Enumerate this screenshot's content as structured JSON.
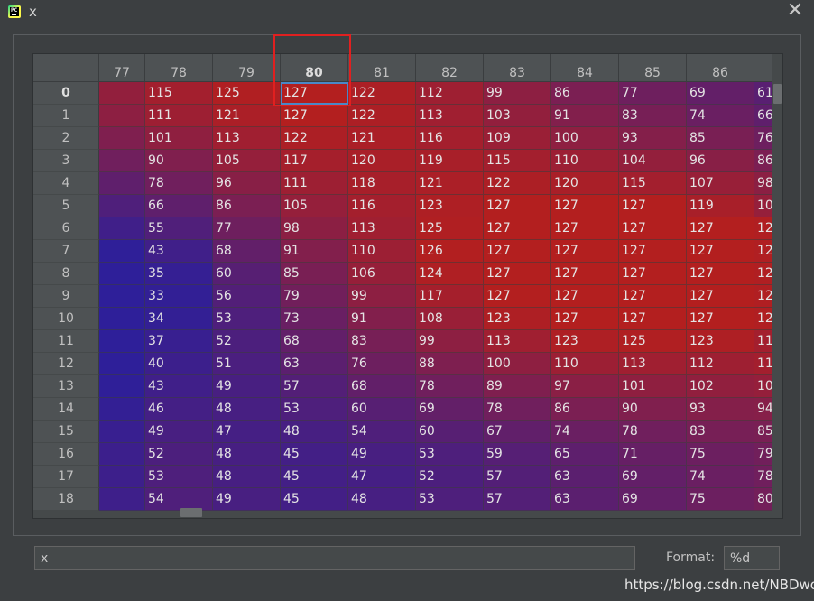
{
  "window": {
    "title": "x",
    "close_symbol": "✕",
    "app_icon_text": "PC"
  },
  "table": {
    "column_headers": [
      "77",
      "78",
      "79",
      "80",
      "81",
      "82",
      "83",
      "84",
      "85",
      "86",
      ""
    ],
    "selected_column": "80",
    "row_headers": [
      "0",
      "1",
      "2",
      "3",
      "4",
      "5",
      "6",
      "7",
      "8",
      "9",
      "10",
      "11",
      "12",
      "13",
      "14",
      "15",
      "16",
      "17",
      "18"
    ],
    "selected_row": "0",
    "selected_cell": {
      "row": 0,
      "column": "80",
      "value": "127"
    },
    "rows": [
      [
        "",
        "115",
        "125",
        "127",
        "122",
        "112",
        "99",
        "86",
        "77",
        "69",
        "61"
      ],
      [
        "",
        "111",
        "121",
        "127",
        "122",
        "113",
        "103",
        "91",
        "83",
        "74",
        "66"
      ],
      [
        "",
        "101",
        "113",
        "122",
        "121",
        "116",
        "109",
        "100",
        "93",
        "85",
        "76"
      ],
      [
        "",
        "90",
        "105",
        "117",
        "120",
        "119",
        "115",
        "110",
        "104",
        "96",
        "86"
      ],
      [
        "",
        "78",
        "96",
        "111",
        "118",
        "121",
        "122",
        "120",
        "115",
        "107",
        "98"
      ],
      [
        "",
        "66",
        "86",
        "105",
        "116",
        "123",
        "127",
        "127",
        "127",
        "119",
        "10"
      ],
      [
        "",
        "55",
        "77",
        "98",
        "113",
        "125",
        "127",
        "127",
        "127",
        "127",
        "12"
      ],
      [
        "",
        "43",
        "68",
        "91",
        "110",
        "126",
        "127",
        "127",
        "127",
        "127",
        "12"
      ],
      [
        "",
        "35",
        "60",
        "85",
        "106",
        "124",
        "127",
        "127",
        "127",
        "127",
        "12"
      ],
      [
        "",
        "33",
        "56",
        "79",
        "99",
        "117",
        "127",
        "127",
        "127",
        "127",
        "12"
      ],
      [
        "",
        "34",
        "53",
        "73",
        "91",
        "108",
        "123",
        "127",
        "127",
        "127",
        "12"
      ],
      [
        "",
        "37",
        "52",
        "68",
        "83",
        "99",
        "113",
        "123",
        "125",
        "123",
        "11"
      ],
      [
        "",
        "40",
        "51",
        "63",
        "76",
        "88",
        "100",
        "110",
        "113",
        "112",
        "11"
      ],
      [
        "",
        "43",
        "49",
        "57",
        "68",
        "78",
        "89",
        "97",
        "101",
        "102",
        "10"
      ],
      [
        "",
        "46",
        "48",
        "53",
        "60",
        "69",
        "78",
        "86",
        "90",
        "93",
        "94"
      ],
      [
        "",
        "49",
        "47",
        "48",
        "54",
        "60",
        "67",
        "74",
        "78",
        "83",
        "85"
      ],
      [
        "",
        "52",
        "48",
        "45",
        "49",
        "53",
        "59",
        "65",
        "71",
        "75",
        "79"
      ],
      [
        "",
        "53",
        "48",
        "45",
        "47",
        "52",
        "57",
        "63",
        "69",
        "74",
        "78"
      ],
      [
        "",
        "54",
        "49",
        "45",
        "48",
        "53",
        "57",
        "63",
        "69",
        "75",
        "80"
      ]
    ],
    "color_low": "#2e1f99",
    "color_high": "#b31f1f"
  },
  "footer": {
    "expression_value": "x",
    "format_label": "Format:",
    "format_value": "%d"
  },
  "watermark": "https://blog.csdn.net/NBDwo",
  "highlight_color": "#e02020"
}
